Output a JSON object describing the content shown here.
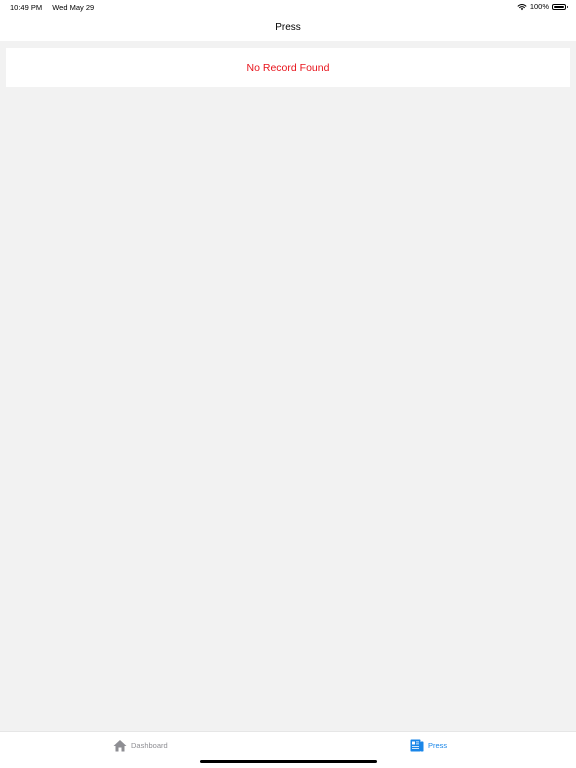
{
  "status_bar": {
    "time": "10:49 PM",
    "date": "Wed May 29",
    "battery": "100%"
  },
  "nav": {
    "title": "Press"
  },
  "content": {
    "empty_message": "No Record Found"
  },
  "tabs": [
    {
      "label": "Dashboard",
      "icon": "home-icon",
      "active": false
    },
    {
      "label": "Press",
      "icon": "newspaper-icon",
      "active": true
    }
  ],
  "colors": {
    "background": "#f2f2f2",
    "empty_message": "#e8131b",
    "tab_active": "#1a86e8",
    "tab_inactive": "#8e8e93"
  }
}
